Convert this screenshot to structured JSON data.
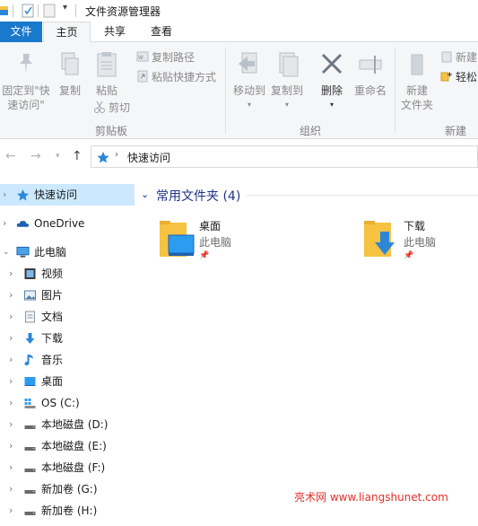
{
  "window": {
    "title": "文件资源管理器"
  },
  "tabs": {
    "file": "文件",
    "home": "主页",
    "share": "共享",
    "view": "查看"
  },
  "ribbon": {
    "pin_quick_access_line1": "固定到\"快",
    "pin_quick_access_line2": "速访问\"",
    "copy": "复制",
    "paste": "粘贴",
    "copy_path": "复制路径",
    "paste_shortcut": "粘贴快捷方式",
    "cut": "剪切",
    "group_clipboard": "剪贴板",
    "move_to": "移动到",
    "copy_to": "复制到",
    "delete": "删除",
    "rename": "重命名",
    "group_organize": "组织",
    "new_folder_line1": "新建",
    "new_folder_line2": "文件夹",
    "new_item": "新建",
    "easy_access": "轻松",
    "group_new": "新建"
  },
  "address": {
    "location": "快速访问"
  },
  "nav": {
    "quick_access": "快速访问",
    "onedrive": "OneDrive",
    "this_pc": "此电脑",
    "videos": "视频",
    "pictures": "图片",
    "documents": "文档",
    "downloads": "下载",
    "music": "音乐",
    "desktop": "桌面",
    "drive_c": "OS (C:)",
    "drive_d": "本地磁盘 (D:)",
    "drive_e": "本地磁盘 (E:)",
    "drive_f": "本地磁盘 (F:)",
    "drive_g": "新加卷 (G:)",
    "drive_h": "新加卷 (H:)"
  },
  "content": {
    "section_title": "常用文件夹 (4)",
    "folders": [
      {
        "name": "桌面",
        "location": "此电脑"
      },
      {
        "name": "下载",
        "location": "此电脑"
      }
    ]
  },
  "watermark": "亮术网 www.liangshunet.com",
  "colors": {
    "accent": "#1979ca",
    "selection": "#cce8ff",
    "section_title": "#1e3287",
    "folder": "#f5c242"
  },
  "icons": [
    "pin-icon",
    "copy-icon",
    "paste-icon",
    "cut-icon",
    "move-to-icon",
    "copy-to-icon",
    "delete-icon",
    "rename-icon",
    "new-folder-icon",
    "back-icon",
    "forward-icon",
    "up-icon",
    "star-icon",
    "cloud-icon",
    "computer-icon",
    "folder-icon"
  ]
}
